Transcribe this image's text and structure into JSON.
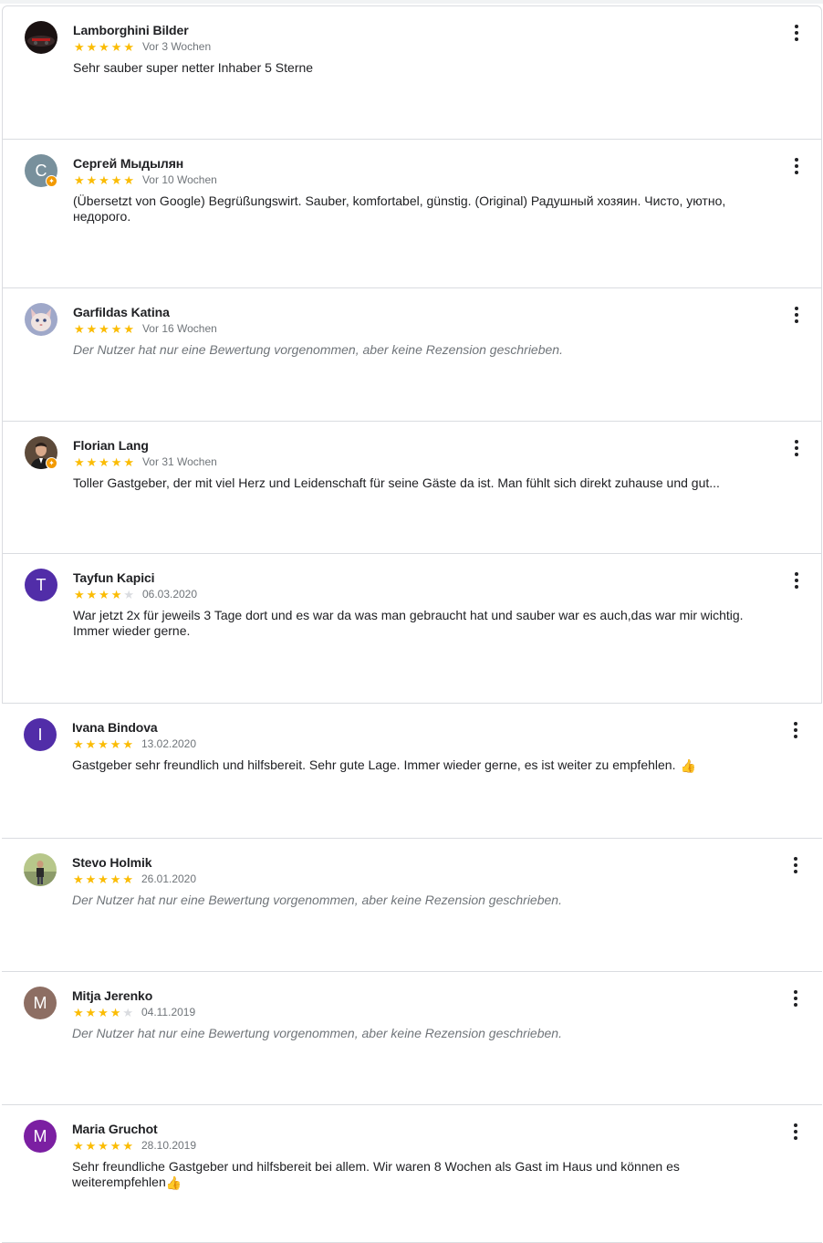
{
  "reviews": [
    {
      "name": "Lamborghini Bilder",
      "rating": 5,
      "date": "Vor 3 Wochen",
      "text": "Sehr sauber super netter Inhaber 5 Sterne",
      "empty": false,
      "avatar": {
        "type": "photo",
        "icon": "car-photo"
      },
      "local_guide": false,
      "height": 145,
      "boxed": true
    },
    {
      "name": "Сергей Мыдылян",
      "rating": 5,
      "date": "Vor 10 Wochen",
      "text": "(Übersetzt von Google) Begrüßungswirt. Sauber, komfortabel, günstig. (Original) Радушный хозяин. Чисто, уютно, недорого.",
      "empty": false,
      "avatar": {
        "type": "letter",
        "letter": "С",
        "color": "#78909c"
      },
      "local_guide": true,
      "height": 162,
      "boxed": true
    },
    {
      "name": "Garfildas Katina",
      "rating": 5,
      "date": "Vor 16 Wochen",
      "text": "Der Nutzer hat nur eine Bewertung vorgenommen, aber keine Rezension geschrieben.",
      "empty": true,
      "avatar": {
        "type": "photo",
        "icon": "cat-photo"
      },
      "local_guide": false,
      "height": 145,
      "boxed": true
    },
    {
      "name": "Florian Lang",
      "rating": 5,
      "date": "Vor 31 Wochen",
      "text": "Toller Gastgeber, der mit viel Herz und Leidenschaft für seine Gäste da ist. Man fühlt sich direkt zuhause und gut...",
      "empty": false,
      "avatar": {
        "type": "photo",
        "icon": "person-photo"
      },
      "local_guide": true,
      "height": 144,
      "boxed": true
    },
    {
      "name": "Tayfun Kapici",
      "rating": 4,
      "date": "06.03.2020",
      "text": "War jetzt 2x für jeweils 3 Tage dort und es war da was man gebraucht hat und sauber war es auch,das war mir wichtig. Immer wieder gerne.",
      "empty": false,
      "avatar": {
        "type": "letter",
        "letter": "T",
        "color": "#512da8"
      },
      "local_guide": false,
      "height": 163,
      "boxed": true
    },
    {
      "name": "Ivana Bindova",
      "rating": 5,
      "date": "13.02.2020",
      "text": "Gastgeber sehr freundlich und hilfsbereit. Sehr gute Lage. Immer wieder gerne, es ist weiter zu empfehlen.",
      "thumb": "👍",
      "empty": false,
      "avatar": {
        "type": "letter",
        "letter": "I",
        "color": "#512da8"
      },
      "local_guide": false,
      "height": 147,
      "boxed": false
    },
    {
      "name": "Stevo Holmik",
      "rating": 5,
      "date": "26.01.2020",
      "text": "Der Nutzer hat nur eine Bewertung vorgenommen, aber keine Rezension geschrieben.",
      "empty": true,
      "avatar": {
        "type": "photo",
        "icon": "person-outdoor-photo"
      },
      "local_guide": false,
      "height": 145,
      "boxed": false
    },
    {
      "name": "Mitja Jerenko",
      "rating": 4,
      "date": "04.11.2019",
      "text": "Der Nutzer hat nur eine Bewertung vorgenommen, aber keine Rezension geschrieben.",
      "empty": true,
      "avatar": {
        "type": "letter",
        "letter": "M",
        "color": "#8d6e63"
      },
      "local_guide": false,
      "height": 145,
      "boxed": false
    },
    {
      "name": "Maria Gruchot",
      "rating": 5,
      "date": "28.10.2019",
      "text": "Sehr freundliche Gastgeber und hilfsbereit bei allem. Wir waren 8 Wochen als Gast im Haus und können es weiterempfehlen",
      "thumb": "👍",
      "empty": false,
      "avatar": {
        "type": "letter",
        "letter": "M",
        "color": "#7b1fa2"
      },
      "local_guide": false,
      "height": 150,
      "boxed": false
    }
  ],
  "local_guide_badge": "✦",
  "star_glyph": "★",
  "icons": {
    "menu": "more-vert-icon",
    "star": "star-icon",
    "badge": "local-guide-badge-icon"
  }
}
